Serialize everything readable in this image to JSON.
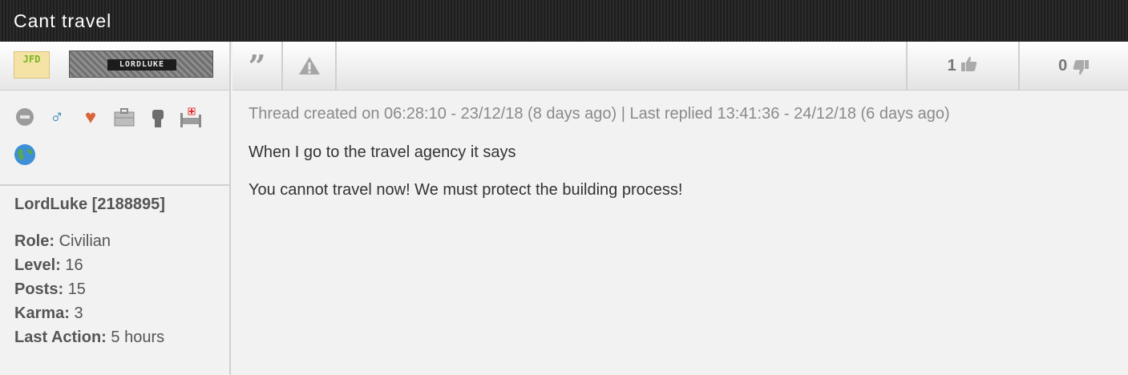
{
  "thread": {
    "title": "Cant travel"
  },
  "user": {
    "faction_tag": "JFD",
    "badge_name": "LORDLUKE",
    "display_name": "LordLuke [2188895]",
    "icons": [
      "online-status-icon",
      "male-icon",
      "heart-icon",
      "briefcase-icon",
      "fist-icon",
      "hospital-bed-icon",
      "globe-icon"
    ],
    "stats": [
      {
        "label": "Role:",
        "value": "Civilian"
      },
      {
        "label": "Level:",
        "value": "16"
      },
      {
        "label": "Posts:",
        "value": "15"
      },
      {
        "label": "Karma:",
        "value": "3"
      },
      {
        "label": "Last Action:",
        "value": "5 hours"
      }
    ]
  },
  "toolbar": {
    "likes": "1",
    "dislikes": "0"
  },
  "post": {
    "meta": "Thread created on 06:28:10 - 23/12/18 (8 days ago) | Last replied 13:41:36 - 24/12/18 (6 days ago)",
    "lines": [
      "When I go to the travel agency it says",
      "You cannot travel now! We must protect the building process!"
    ]
  }
}
